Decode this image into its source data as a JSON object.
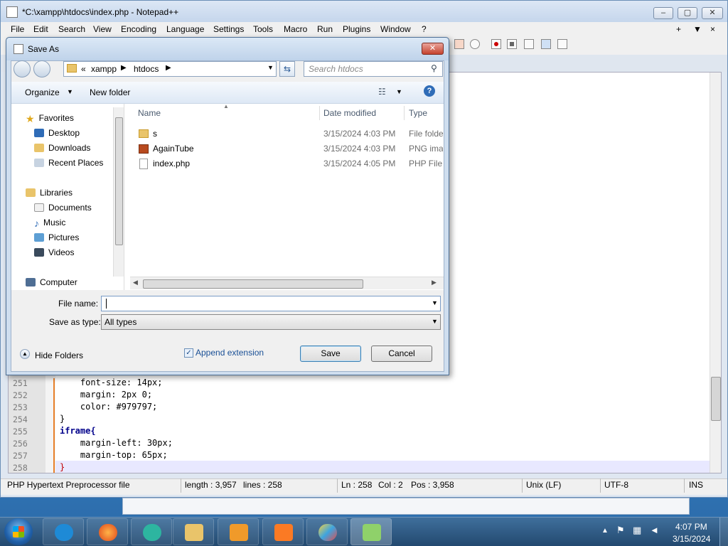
{
  "notepad": {
    "title": "*C:\\xampp\\htdocs\\index.php - Notepad++",
    "menu": [
      "File",
      "Edit",
      "Search",
      "View",
      "Encoding",
      "Language",
      "Settings",
      "Tools",
      "Macro",
      "Run",
      "Plugins",
      "Window",
      "?"
    ],
    "menu_right": [
      "+",
      "▼",
      "×"
    ],
    "code_lines": [
      {
        "num": "251",
        "text": "    font-size: 14px;"
      },
      {
        "num": "252",
        "text": "    margin: 2px 0;"
      },
      {
        "num": "253",
        "text": "    color: #979797;"
      },
      {
        "num": "254",
        "text": "}"
      },
      {
        "num": "255",
        "text": "iframe{"
      },
      {
        "num": "256",
        "text": "    margin-left: 30px;"
      },
      {
        "num": "257",
        "text": "    margin-top: 65px;"
      },
      {
        "num": "258",
        "text": "}"
      }
    ],
    "status": {
      "file_type": "PHP Hypertext Preprocessor file",
      "length": "length : 3,957",
      "lines": "lines : 258",
      "ln": "Ln : 258",
      "col": "Col : 2",
      "pos": "Pos : 3,958",
      "eol": "Unix (LF)",
      "encoding": "UTF-8",
      "mode": "INS"
    }
  },
  "dialog": {
    "title": "Save As",
    "breadcrumb": [
      "«",
      "xampp",
      "htdocs"
    ],
    "search_placeholder": "Search htdocs",
    "organize": "Organize",
    "new_folder": "New folder",
    "nav": {
      "favorites": "Favorites",
      "favorites_items": [
        "Desktop",
        "Downloads",
        "Recent Places"
      ],
      "libraries": "Libraries",
      "libraries_items": [
        "Documents",
        "Music",
        "Pictures",
        "Videos"
      ],
      "computer": "Computer"
    },
    "columns": [
      "Name",
      "Date modified",
      "Type"
    ],
    "files": [
      {
        "name": "s",
        "date": "3/15/2024 4:03 PM",
        "type": "File folder",
        "icon": "folder-icon"
      },
      {
        "name": "AgainTube",
        "date": "3/15/2024 4:03 PM",
        "type": "PNG imag",
        "icon": "png-image-icon"
      },
      {
        "name": "index.php",
        "date": "3/15/2024 4:05 PM",
        "type": "PHP File",
        "icon": "php-file-icon"
      }
    ],
    "file_name_label": "File name:",
    "file_name_value": "",
    "save_type_label": "Save as type:",
    "save_type_value": "All types",
    "hide_folders": "Hide Folders",
    "append_extension": "Append extension",
    "append_checked": true,
    "save": "Save",
    "cancel": "Cancel"
  },
  "taskbar": {
    "time": "4:07 PM",
    "date": "3/15/2024",
    "apps": [
      "internet-explorer-icon",
      "firefox-icon",
      "app-icon",
      "file-explorer-icon",
      "media-player-icon",
      "xampp-icon",
      "paint-icon",
      "notepadpp-icon"
    ]
  },
  "colors": {
    "accent": "#3b6ea5",
    "fold_marker": "#e8802a",
    "keyword": "#0000ff"
  }
}
